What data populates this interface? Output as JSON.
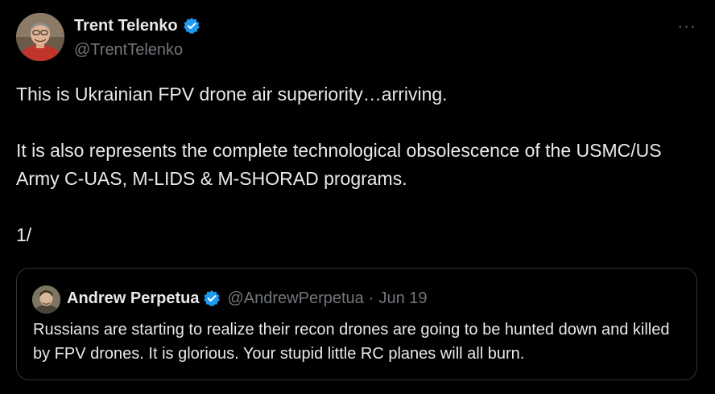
{
  "author": {
    "display_name": "Trent Telenko",
    "handle": "@TrentTelenko",
    "avatar_icon": "profile-photo"
  },
  "more_icon": "ellipsis-icon",
  "more_label": "···",
  "tweet_text": {
    "line1": "This is Ukrainian FPV drone air superiority…arriving.",
    "para2": "It is also represents the complete technological obsolescence of the USMC/US Army C-UAS, M-LIDS & M-SHORAD programs.",
    "para3": "1/"
  },
  "quoted_tweet": {
    "display_name": "Andrew Perpetua",
    "handle": "@AndrewPerpetua",
    "separator": "·",
    "date": "Jun 19",
    "text": "Russians are starting to realize their recon drones are going to be hunted down and killed by FPV drones. It is glorious. Your stupid little RC planes will all burn."
  },
  "colors": {
    "background": "#000000",
    "text_primary": "#e7e9ea",
    "text_secondary": "#71767b",
    "verified_blue": "#1d9bf0",
    "border": "#2f3336"
  }
}
